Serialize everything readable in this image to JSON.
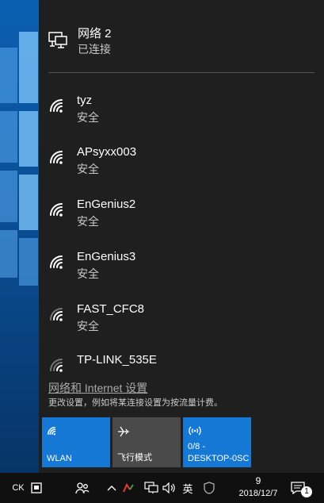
{
  "connected_network": {
    "name": "网络  2",
    "status": "已连接"
  },
  "wifi_networks": [
    {
      "ssid": "tyz",
      "security": "安全"
    },
    {
      "ssid": "APsyxx003",
      "security": "安全"
    },
    {
      "ssid": "EnGenius2",
      "security": "安全"
    },
    {
      "ssid": "EnGenius3",
      "security": "安全"
    },
    {
      "ssid": "FAST_CFC8",
      "security": "安全"
    },
    {
      "ssid": "TP-LINK_535E",
      "security": ""
    }
  ],
  "settings": {
    "link": "网络和 Internet 设置",
    "description": "更改设置，例如将某连接设置为按流量计费。"
  },
  "quick_actions": {
    "wlan_label": "WLAN",
    "airplane_label": "飞行模式",
    "hotspot_value": "0/8 -",
    "hotspot_label": "DESKTOP-0SC"
  },
  "taskbar": {
    "ime_label": "CK",
    "language": "英",
    "time": "9",
    "date": "2018/12/7",
    "notification_count": "1"
  },
  "colors": {
    "flyout_bg": "#1f1f1f",
    "accent": "#1478d4",
    "tile_off": "#4a4a4a",
    "taskbar_bg": "#101010"
  }
}
